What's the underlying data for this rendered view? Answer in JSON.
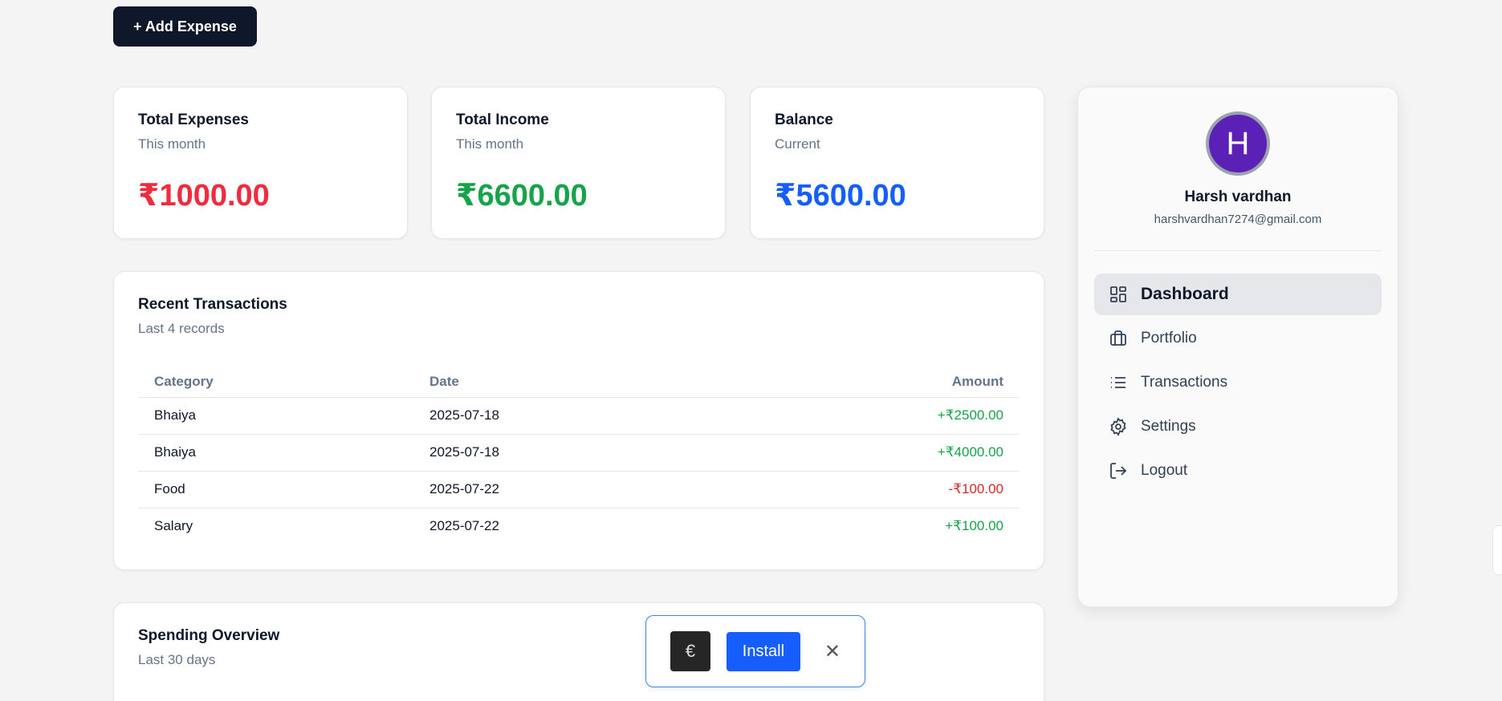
{
  "toolbar": {
    "add_expense_label": "+ Add Expense"
  },
  "stats": {
    "expenses": {
      "title": "Total Expenses",
      "subtitle": "This month",
      "value": "₹1000.00",
      "color": "#ef2b3d"
    },
    "income": {
      "title": "Total Income",
      "subtitle": "This month",
      "value": "₹6600.00",
      "color": "#16a34a"
    },
    "balance": {
      "title": "Balance",
      "subtitle": "Current",
      "value": "₹5600.00",
      "color": "#155dfc"
    }
  },
  "transactions": {
    "title": "Recent Transactions",
    "subtitle": "Last 4 records",
    "columns": [
      "Category",
      "Date",
      "Amount"
    ],
    "rows": [
      {
        "category": "Bhaiya",
        "date": "2025-07-18",
        "amount": "+₹2500.00"
      },
      {
        "category": "Bhaiya",
        "date": "2025-07-18",
        "amount": "+₹4000.00"
      },
      {
        "category": "Food",
        "date": "2025-07-22",
        "amount": "-₹100.00"
      },
      {
        "category": "Salary",
        "date": "2025-07-22",
        "amount": "+₹100.00"
      }
    ]
  },
  "overview": {
    "title": "Spending Overview",
    "subtitle": "Last 30 days"
  },
  "user": {
    "initial": "H",
    "name": "Harsh vardhan",
    "email": "harshvardhan7274@gmail.com"
  },
  "nav": [
    {
      "label": "Dashboard",
      "icon": "dashboard-icon",
      "active": true
    },
    {
      "label": "Portfolio",
      "icon": "briefcase-icon"
    },
    {
      "label": "Transactions",
      "icon": "list-icon"
    },
    {
      "label": "Settings",
      "icon": "gear-icon"
    },
    {
      "label": "Logout",
      "icon": "logout-icon"
    }
  ],
  "install_prompt": {
    "button_label": "Install",
    "close_symbol": "✕"
  }
}
